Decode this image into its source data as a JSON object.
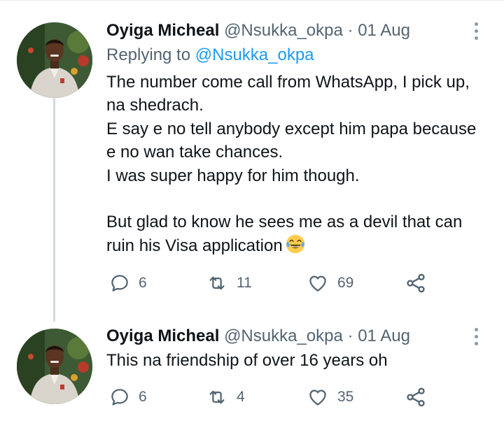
{
  "tweets": [
    {
      "name": "Oyiga Micheal",
      "handle": "@Nsukka_okpa",
      "separator": "·",
      "date": "01 Aug",
      "replying_prefix": "Replying to",
      "replying_handle": "@Nsukka_okpa",
      "lines": [
        "The number come call from WhatsApp, I pick up,",
        "na shedrach.",
        "E say e no tell anybody except him papa because",
        "e no wan take chances.",
        "I was super happy for him though.",
        "",
        "But glad to know he sees me as a devil that can",
        "ruin his Visa application"
      ],
      "emoji": "face-with-tears-of-joy",
      "stats": {
        "replies": "6",
        "retweets": "11",
        "likes": "69"
      }
    },
    {
      "name": "Oyiga Micheal",
      "handle": "@Nsukka_okpa",
      "separator": "·",
      "date": "01 Aug",
      "lines": [
        "This na friendship of over 16 years oh"
      ],
      "stats": {
        "replies": "6",
        "retweets": "4",
        "likes": "35"
      }
    }
  ],
  "icons": {
    "reply": "reply-bubble-icon",
    "retweet": "retweet-icon",
    "like": "heart-icon",
    "share": "share-icon",
    "more": "more-vertical-icon"
  },
  "colors": {
    "text": "#0f1419",
    "secondary": "#536471",
    "link": "#1d9bf0",
    "thread_line": "#cfd9de"
  }
}
